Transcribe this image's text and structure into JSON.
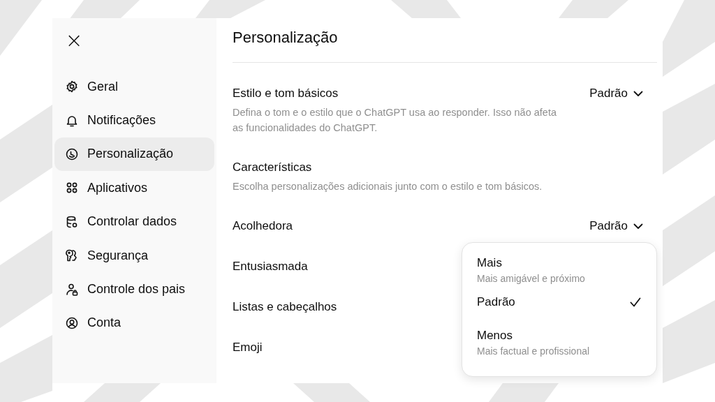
{
  "sidebar": {
    "close": "×",
    "items": [
      {
        "label": "Geral",
        "selected": false
      },
      {
        "label": "Notificações",
        "selected": false
      },
      {
        "label": "Personalização",
        "selected": true
      },
      {
        "label": "Aplicativos",
        "selected": false
      },
      {
        "label": "Controlar dados",
        "selected": false
      },
      {
        "label": "Segurança",
        "selected": false
      },
      {
        "label": "Controle dos pais",
        "selected": false
      },
      {
        "label": "Conta",
        "selected": false
      }
    ]
  },
  "main": {
    "title": "Personalização",
    "rows": [
      {
        "label": "Estilo e tom básicos",
        "value": "Padrão",
        "description": "Defina o tom e o estilo que o ChatGPT usa ao responder. Isso não afeta as funcionalidades do ChatGPT."
      },
      {
        "label": "Características",
        "description": "Escolha personalizações adicionais junto com o estilo e tom básicos."
      },
      {
        "label": "Acolhedora",
        "value": "Padrão"
      },
      {
        "label": "Entusiasmada"
      },
      {
        "label": "Listas e cabeçalhos"
      },
      {
        "label": "Emoji"
      }
    ]
  },
  "dropdown": {
    "options": [
      {
        "label": "Mais",
        "description": "Mais amigável e próximo",
        "selected": false
      },
      {
        "label": "Padrão",
        "selected": true
      },
      {
        "label": "Menos",
        "description": "Mais factual e profissional",
        "selected": false
      }
    ]
  }
}
